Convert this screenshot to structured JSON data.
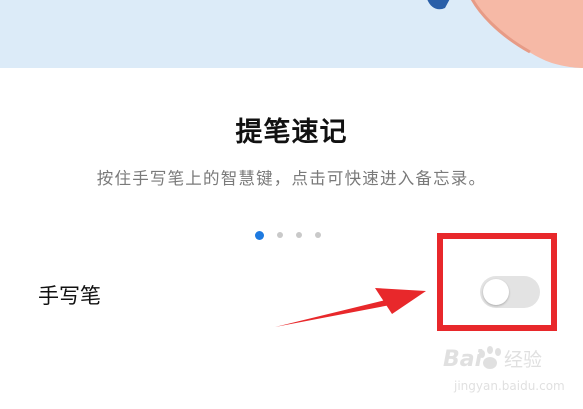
{
  "colors": {
    "banner_bg": "#dcebf8",
    "accent": "#1e7ae0",
    "highlight_red": "#e8282b",
    "toggle_off": "#e3e3e3"
  },
  "content": {
    "title": "提笔速记",
    "subtitle": "按住手写笔上的智慧键，点击可快速进入备忘录。"
  },
  "pager": {
    "count": 4,
    "active_index": 0
  },
  "setting": {
    "label": "手写笔",
    "toggle_on": false
  },
  "watermark": {
    "text": "Bai 经验",
    "url": "jingyan.baidu.com"
  }
}
